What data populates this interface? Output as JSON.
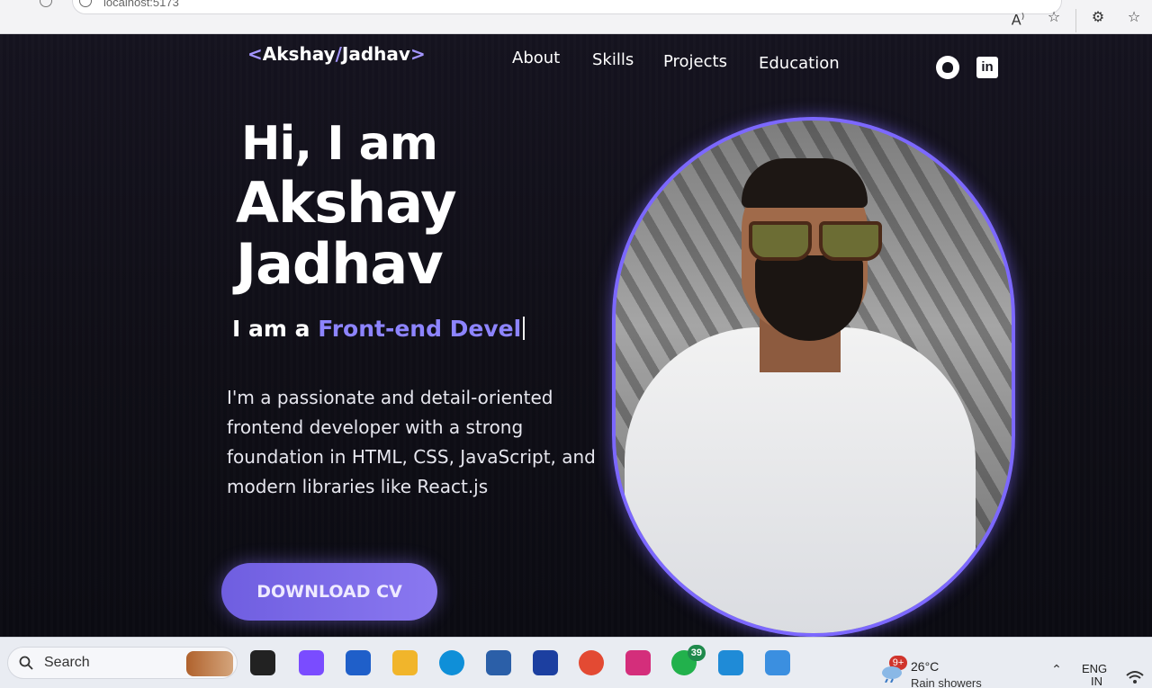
{
  "browser": {
    "url": "localhost:5173",
    "icons": [
      "read-aloud-icon",
      "favorite-star-icon",
      "extensions-icon",
      "favorites-list-icon"
    ]
  },
  "nav": {
    "logo_open": "<",
    "logo_first": "Akshay",
    "logo_slash": "/",
    "logo_last": "Jadhav",
    "logo_close": ">",
    "links": [
      "About",
      "Skills",
      "Projects",
      "Education"
    ],
    "social": [
      "github-icon",
      "linkedin-icon"
    ],
    "linkedin_text": "in"
  },
  "hero": {
    "greeting": "Hi, I am",
    "name": "Akshay Jadhav",
    "role_prefix": "I am a",
    "role_typed": "Front-end Devel",
    "bio": "I'm a passionate and detail-oriented frontend developer with a strong foundation in HTML, CSS, JavaScript, and modern libraries like React.js",
    "cta": "DOWNLOAD CV"
  },
  "taskbar": {
    "search_placeholder": "Search",
    "apps": [
      {
        "name": "task-view-icon",
        "color": "#222"
      },
      {
        "name": "copilot-icon",
        "color": "#7a4cff"
      },
      {
        "name": "microsoft-store-icon",
        "color": "#1f5fc9"
      },
      {
        "name": "file-explorer-icon",
        "color": "#f1b52b"
      },
      {
        "name": "edge-icon",
        "color": "#0f8fd8"
      },
      {
        "name": "app-icon",
        "color": "#2b5fa8"
      },
      {
        "name": "app-icon-2",
        "color": "#1c3fa0"
      },
      {
        "name": "chrome-icon",
        "color": "#e34a33"
      },
      {
        "name": "instagram-icon",
        "color": "#d42e7b"
      },
      {
        "name": "whatsapp-icon",
        "color": "#22b14c"
      },
      {
        "name": "vscode-icon",
        "color": "#1f8bd7"
      },
      {
        "name": "photos-icon",
        "color": "#3b8fe0"
      }
    ],
    "whatsapp_badge": "39",
    "weather_badge": "9+",
    "weather_temp": "26°C",
    "weather_desc": "Rain showers",
    "lang_top": "ENG",
    "lang_bottom": "IN"
  }
}
